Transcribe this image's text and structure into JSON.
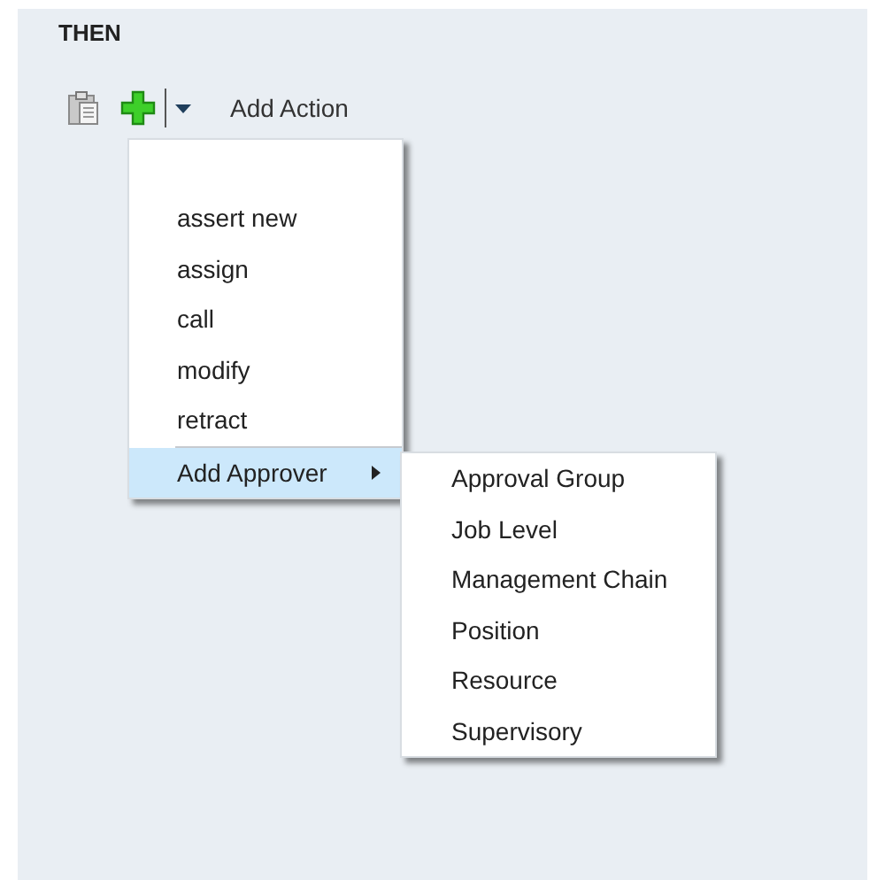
{
  "section_title": "THEN",
  "toolbar": {
    "add_action_label": "Add Action"
  },
  "menu": {
    "items": [
      {
        "label": "assert new",
        "kind": "action",
        "selected": false
      },
      {
        "label": "assign",
        "kind": "action",
        "selected": false
      },
      {
        "label": "call",
        "kind": "action",
        "selected": false
      },
      {
        "label": "modify",
        "kind": "action",
        "selected": false
      },
      {
        "label": "retract",
        "kind": "action",
        "selected": false
      },
      {
        "label": "Add Approver",
        "kind": "submenu",
        "selected": true
      }
    ]
  },
  "submenu": {
    "items": [
      {
        "label": "Approval Group",
        "selected": false
      },
      {
        "label": "Job Level",
        "selected": false
      },
      {
        "label": "Management Chain",
        "selected": false
      },
      {
        "label": "Position",
        "selected": false
      },
      {
        "label": "Resource",
        "selected": false
      },
      {
        "label": "Supervisory",
        "selected": false
      }
    ]
  }
}
